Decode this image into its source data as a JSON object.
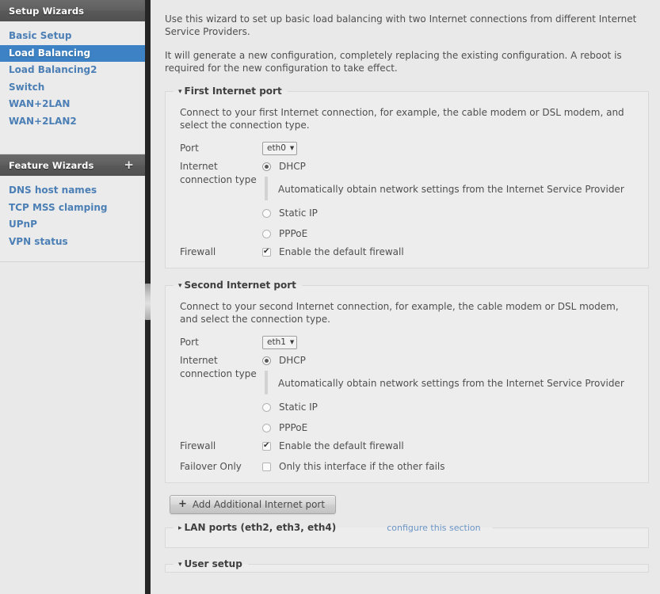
{
  "sidebar": {
    "setup_panel": {
      "header": "Setup Wizards",
      "items": [
        {
          "label": "Basic Setup",
          "active": false
        },
        {
          "label": "Load Balancing",
          "active": true
        },
        {
          "label": "Load Balancing2",
          "active": false
        },
        {
          "label": "Switch",
          "active": false
        },
        {
          "label": "WAN+2LAN",
          "active": false
        },
        {
          "label": "WAN+2LAN2",
          "active": false
        }
      ]
    },
    "feature_panel": {
      "header": "Feature Wizards",
      "add_icon": "+",
      "items": [
        {
          "label": "DNS host names"
        },
        {
          "label": "TCP MSS clamping"
        },
        {
          "label": "UPnP"
        },
        {
          "label": "VPN status"
        }
      ]
    }
  },
  "main": {
    "intro": {
      "paragraph1": "Use this wizard to set up basic load balancing with two Internet connections from different Internet Service Providers.",
      "paragraph2": "It will generate a new configuration, completely replacing the existing configuration. A reboot is required for the new configuration to take effect."
    },
    "first_port": {
      "legend": "First Internet port",
      "caret": "▾",
      "description": "Connect to your first Internet connection, for example, the cable modem or DSL modem, and select the connection type.",
      "port_label": "Port",
      "port_value": "eth0",
      "port_caret": "▼",
      "conn_label_line1": "Internet",
      "conn_label_line2": "connection type",
      "dhcp_label": "DHCP",
      "dhcp_desc": "Automatically obtain network settings from the Internet Service Provider",
      "static_label": "Static IP",
      "pppoe_label": "PPPoE",
      "firewall_label": "Firewall",
      "firewall_checkbox_label": "Enable the default firewall"
    },
    "second_port": {
      "legend": "Second Internet port",
      "caret": "▾",
      "description": "Connect to your second Internet connection, for example, the cable modem or DSL modem, and select the connection type.",
      "port_label": "Port",
      "port_value": "eth1",
      "port_caret": "▼",
      "conn_label_line1": "Internet",
      "conn_label_line2": "connection type",
      "dhcp_label": "DHCP",
      "dhcp_desc": "Automatically obtain network settings from the Internet Service Provider",
      "static_label": "Static IP",
      "pppoe_label": "PPPoE",
      "firewall_label": "Firewall",
      "firewall_checkbox_label": "Enable the default firewall",
      "failover_label": "Failover Only",
      "failover_checkbox_label": "Only this interface if the other fails"
    },
    "add_button": {
      "icon": "+",
      "label": "Add Additional Internet port"
    },
    "lan_section": {
      "legend": "LAN ports (eth2, eth3, eth4)",
      "caret": "▸",
      "link": "configure this section"
    },
    "user_section": {
      "legend": "User setup",
      "caret": "▾"
    }
  },
  "colors": {
    "accent": "#3c82c4",
    "link": "#4b7fb5",
    "gutter": "#262626",
    "page_bg": "#e9e9e9"
  }
}
